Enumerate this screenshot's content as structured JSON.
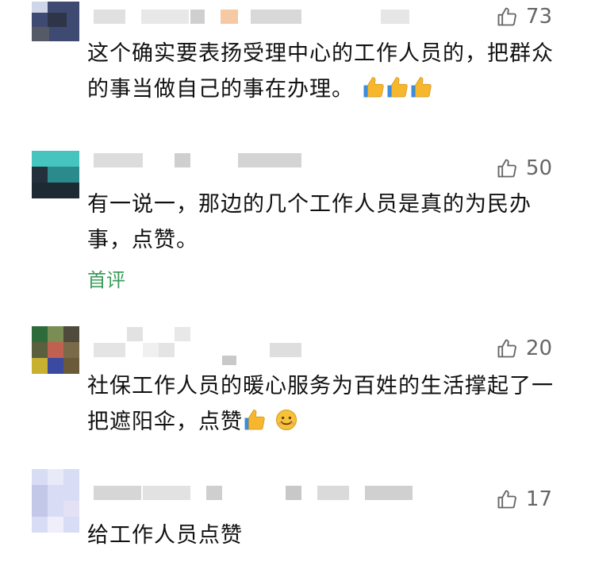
{
  "comments": [
    {
      "likes": "73",
      "text": "这个确实要表扬受理中心的工作人员的，把群众的事当做自己的事在办理。",
      "emoji": [
        "thumbs-up",
        "thumbs-up",
        "thumbs-up"
      ]
    },
    {
      "likes": "50",
      "text": "有一说一，那边的几个工作人员是真的为民办事，点赞。",
      "badge": "首评"
    },
    {
      "likes": "20",
      "text": "社保工作人员的暖心服务为百姓的生活撑起了一把遮阳伞，点赞",
      "emoji": [
        "thumbs-up",
        "smile"
      ]
    },
    {
      "likes": "17",
      "text": "给工作人员点赞"
    }
  ],
  "colors": {
    "badge": "#3a9d5d",
    "like_count": "#666666",
    "text": "#111111"
  },
  "icons": {
    "like": "thumbs-up-outline-icon"
  }
}
